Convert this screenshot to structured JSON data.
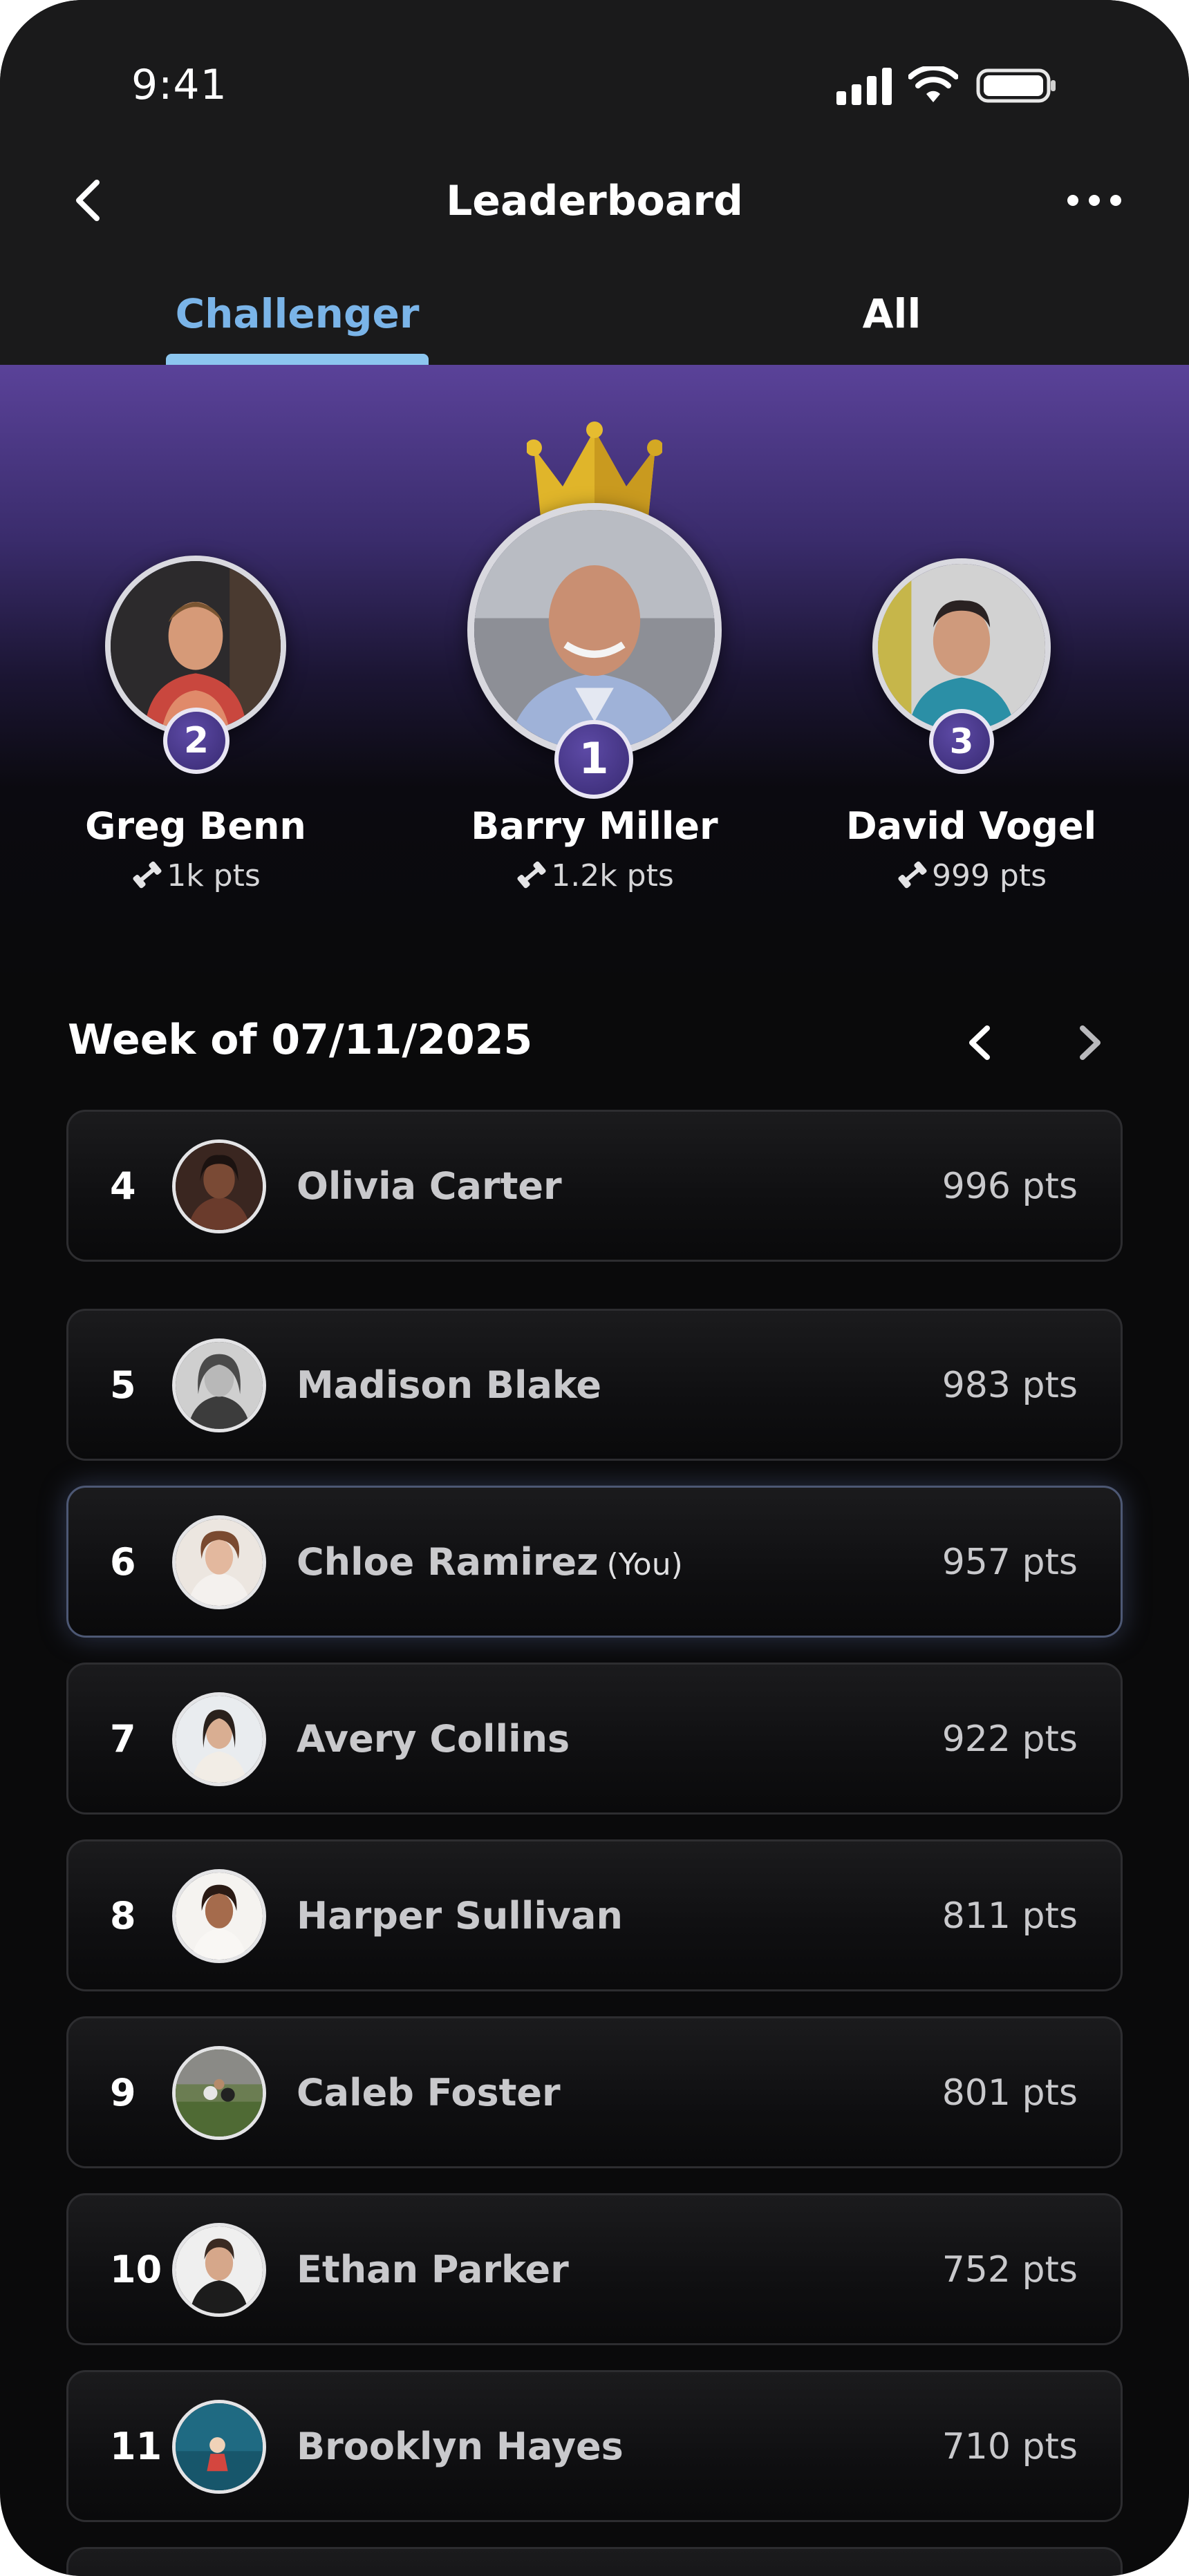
{
  "status_bar": {
    "time": "9:41"
  },
  "header": {
    "title": "Leaderboard"
  },
  "tabs": [
    {
      "label": "Challenger",
      "active": true
    },
    {
      "label": "All",
      "active": false
    }
  ],
  "podium": [
    {
      "rank": "2",
      "name": "Greg Benn",
      "points": "1k pts"
    },
    {
      "rank": "1",
      "name": "Barry Miller",
      "points": "1.2k pts"
    },
    {
      "rank": "3",
      "name": "David Vogel",
      "points": "999 pts"
    }
  ],
  "week": {
    "label": "Week of 07/11/2025"
  },
  "you_label": "(You)",
  "leaderboard": [
    {
      "rank": "4",
      "name": "Olivia Carter",
      "points": "996 pts",
      "is_you": false
    },
    {
      "rank": "5",
      "name": "Madison Blake",
      "points": "983 pts",
      "is_you": false
    },
    {
      "rank": "6",
      "name": "Chloe Ramirez",
      "points": "957 pts",
      "is_you": true
    },
    {
      "rank": "7",
      "name": "Avery Collins",
      "points": "922 pts",
      "is_you": false
    },
    {
      "rank": "8",
      "name": "Harper Sullivan",
      "points": "811 pts",
      "is_you": false
    },
    {
      "rank": "9",
      "name": "Caleb Foster",
      "points": "801 pts",
      "is_you": false
    },
    {
      "rank": "10",
      "name": "Ethan Parker",
      "points": "752 pts",
      "is_you": false
    },
    {
      "rank": "11",
      "name": "Brooklyn Hayes",
      "points": "710 pts",
      "is_you": false
    }
  ],
  "colors": {
    "background": "#0a0a0b",
    "header_bg": "#1a1a1b",
    "active_tab": "#7ab4e8",
    "podium_gradient_top": "#5a4299",
    "badge": "#3d2e78",
    "crown": "#e0b52a"
  },
  "icons": {
    "back": "chevron-left-icon",
    "more": "more-horizontal-icon",
    "points": "dumbbell-icon",
    "crown": "crown-icon",
    "week_prev": "chevron-left-icon",
    "week_next": "chevron-right-icon"
  }
}
